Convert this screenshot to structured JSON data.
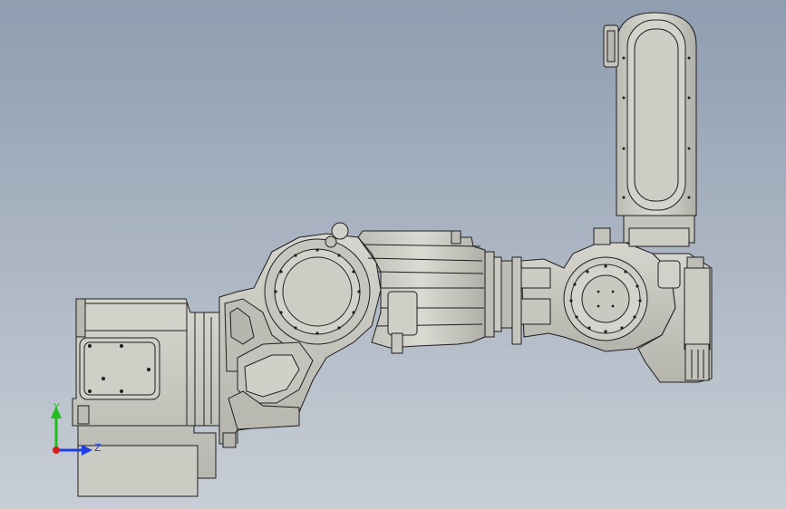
{
  "viewport": {
    "background_top": "#8f9db0",
    "background_bottom": "#c8ced6",
    "part_fill": "#c9c9c1",
    "part_shadow": "#a9a9a1",
    "edge_color": "#1e1e1e"
  },
  "triad": {
    "y_label": "Y",
    "z_label": "Z",
    "y_color": "#1fbf1f",
    "z_color": "#1f3fe0",
    "x_color": "#d01f1f"
  }
}
